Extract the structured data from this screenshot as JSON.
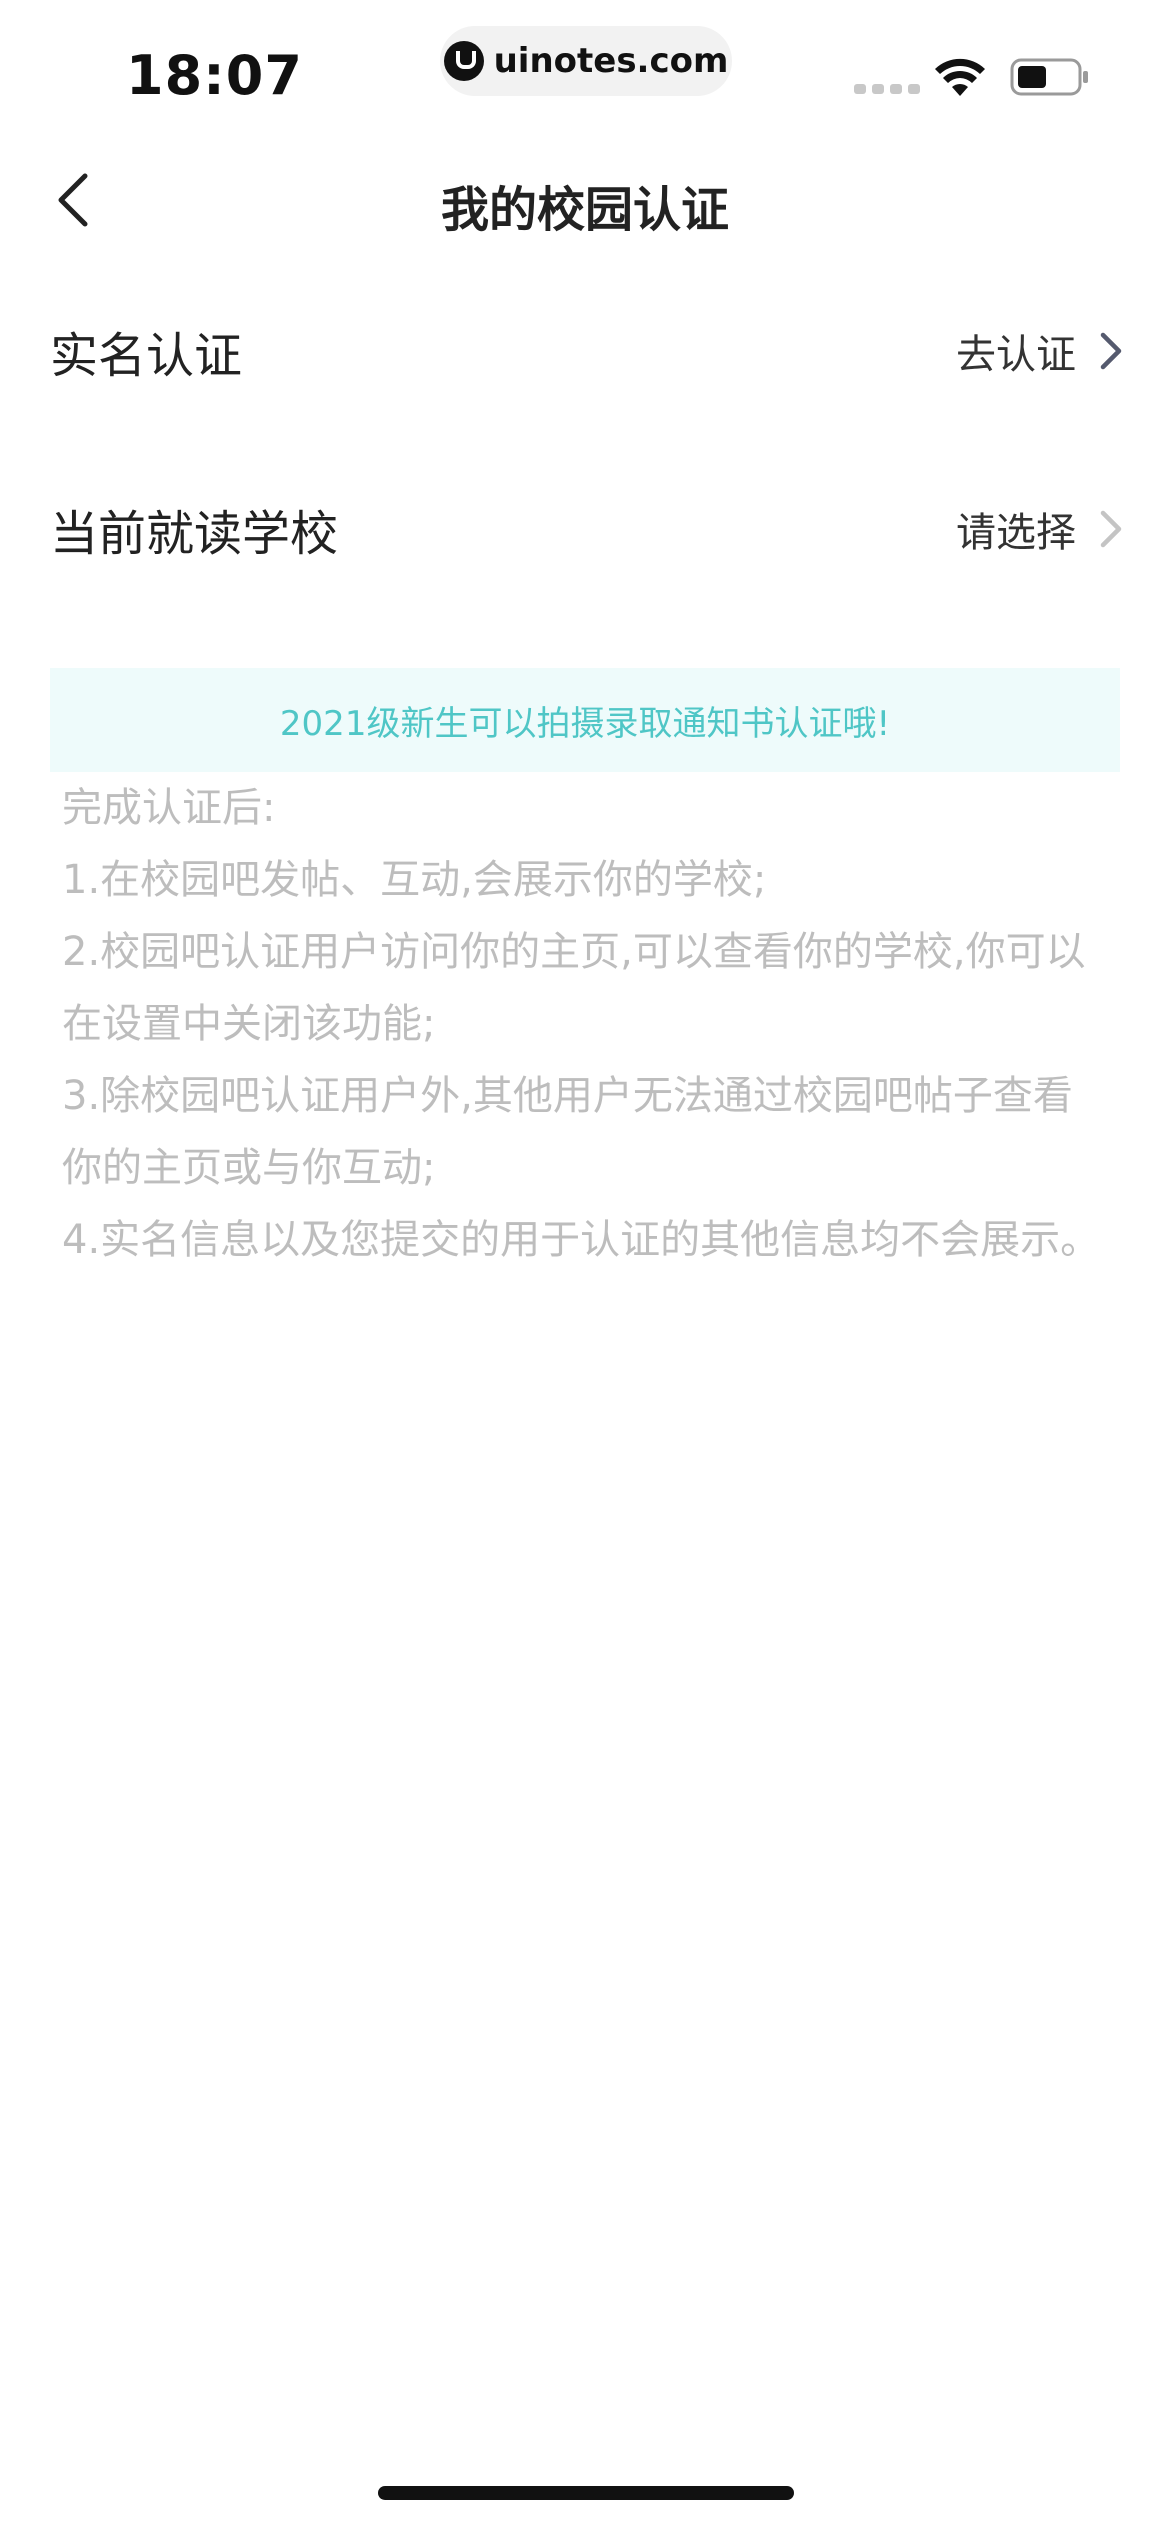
{
  "status_bar": {
    "time": "18:07",
    "url": "uinotes.com",
    "signal_icon": "cellular-signal-icon",
    "wifi_icon": "wifi-icon",
    "battery_icon": "battery-icon"
  },
  "nav": {
    "title": "我的校园认证",
    "back_icon": "chevron-left-icon"
  },
  "rows": [
    {
      "label": "实名认证",
      "action": "去认证",
      "chevron_color": "#555a6e"
    },
    {
      "label": "当前就读学校",
      "action": "请选择",
      "chevron_color": "#c4c4c4"
    }
  ],
  "tip": {
    "text": "2021级新生可以拍摄录取通知书认证哦!"
  },
  "info": {
    "heading": "完成认证后:",
    "items": [
      "1.在校园吧发帖、互动,会展示你的学校;",
      "2.校园吧认证用户访问你的主页,可以查看你的学校,你可以在设置中关闭该功能;",
      "3.除校园吧认证用户外,其他用户无法通过校园吧帖子查看你的主页或与你互动;",
      "4.实名信息以及您提交的用于认证的其他信息均不会展示。"
    ]
  },
  "colors": {
    "tip_background": "#eefbfb",
    "tip_text": "#4fc6c6",
    "info_text": "#bdbdbd"
  }
}
